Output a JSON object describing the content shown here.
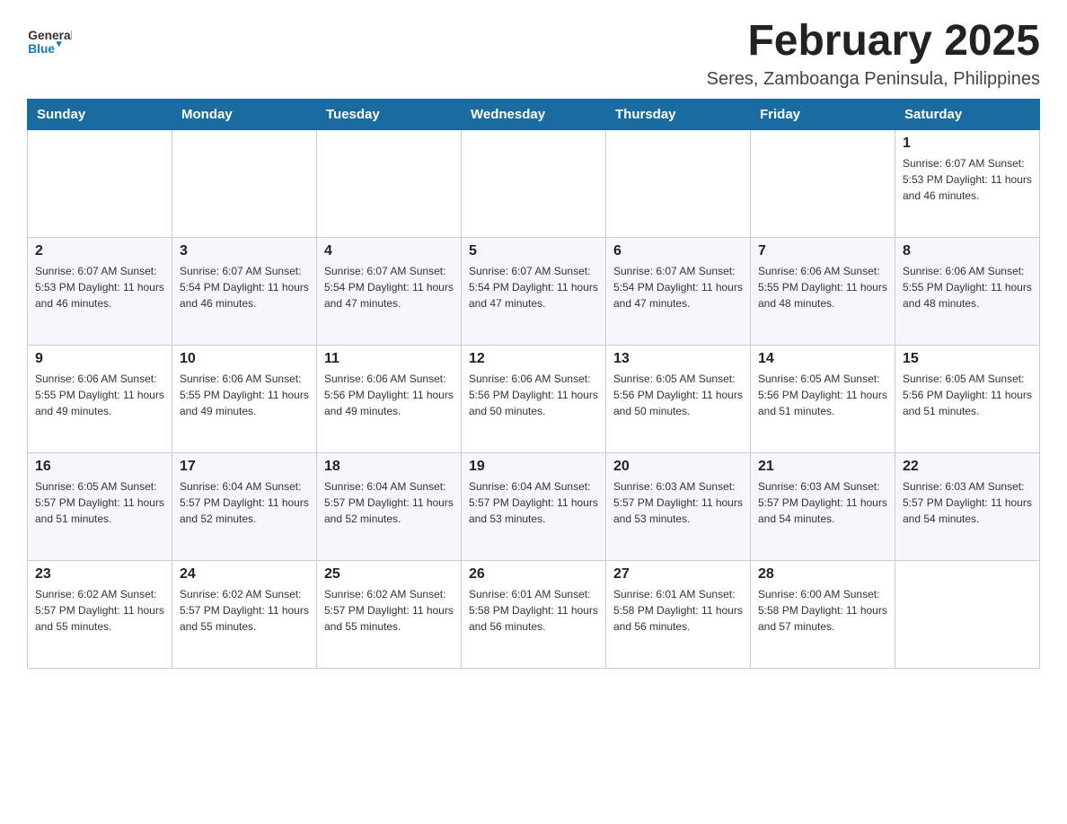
{
  "header": {
    "logo_general": "General",
    "logo_blue": "Blue",
    "month_title": "February 2025",
    "location": "Seres, Zamboanga Peninsula, Philippines"
  },
  "weekdays": [
    "Sunday",
    "Monday",
    "Tuesday",
    "Wednesday",
    "Thursday",
    "Friday",
    "Saturday"
  ],
  "weeks": [
    {
      "days": [
        {
          "num": "",
          "info": ""
        },
        {
          "num": "",
          "info": ""
        },
        {
          "num": "",
          "info": ""
        },
        {
          "num": "",
          "info": ""
        },
        {
          "num": "",
          "info": ""
        },
        {
          "num": "",
          "info": ""
        },
        {
          "num": "1",
          "info": "Sunrise: 6:07 AM\nSunset: 5:53 PM\nDaylight: 11 hours\nand 46 minutes."
        }
      ]
    },
    {
      "days": [
        {
          "num": "2",
          "info": "Sunrise: 6:07 AM\nSunset: 5:53 PM\nDaylight: 11 hours\nand 46 minutes."
        },
        {
          "num": "3",
          "info": "Sunrise: 6:07 AM\nSunset: 5:54 PM\nDaylight: 11 hours\nand 46 minutes."
        },
        {
          "num": "4",
          "info": "Sunrise: 6:07 AM\nSunset: 5:54 PM\nDaylight: 11 hours\nand 47 minutes."
        },
        {
          "num": "5",
          "info": "Sunrise: 6:07 AM\nSunset: 5:54 PM\nDaylight: 11 hours\nand 47 minutes."
        },
        {
          "num": "6",
          "info": "Sunrise: 6:07 AM\nSunset: 5:54 PM\nDaylight: 11 hours\nand 47 minutes."
        },
        {
          "num": "7",
          "info": "Sunrise: 6:06 AM\nSunset: 5:55 PM\nDaylight: 11 hours\nand 48 minutes."
        },
        {
          "num": "8",
          "info": "Sunrise: 6:06 AM\nSunset: 5:55 PM\nDaylight: 11 hours\nand 48 minutes."
        }
      ]
    },
    {
      "days": [
        {
          "num": "9",
          "info": "Sunrise: 6:06 AM\nSunset: 5:55 PM\nDaylight: 11 hours\nand 49 minutes."
        },
        {
          "num": "10",
          "info": "Sunrise: 6:06 AM\nSunset: 5:55 PM\nDaylight: 11 hours\nand 49 minutes."
        },
        {
          "num": "11",
          "info": "Sunrise: 6:06 AM\nSunset: 5:56 PM\nDaylight: 11 hours\nand 49 minutes."
        },
        {
          "num": "12",
          "info": "Sunrise: 6:06 AM\nSunset: 5:56 PM\nDaylight: 11 hours\nand 50 minutes."
        },
        {
          "num": "13",
          "info": "Sunrise: 6:05 AM\nSunset: 5:56 PM\nDaylight: 11 hours\nand 50 minutes."
        },
        {
          "num": "14",
          "info": "Sunrise: 6:05 AM\nSunset: 5:56 PM\nDaylight: 11 hours\nand 51 minutes."
        },
        {
          "num": "15",
          "info": "Sunrise: 6:05 AM\nSunset: 5:56 PM\nDaylight: 11 hours\nand 51 minutes."
        }
      ]
    },
    {
      "days": [
        {
          "num": "16",
          "info": "Sunrise: 6:05 AM\nSunset: 5:57 PM\nDaylight: 11 hours\nand 51 minutes."
        },
        {
          "num": "17",
          "info": "Sunrise: 6:04 AM\nSunset: 5:57 PM\nDaylight: 11 hours\nand 52 minutes."
        },
        {
          "num": "18",
          "info": "Sunrise: 6:04 AM\nSunset: 5:57 PM\nDaylight: 11 hours\nand 52 minutes."
        },
        {
          "num": "19",
          "info": "Sunrise: 6:04 AM\nSunset: 5:57 PM\nDaylight: 11 hours\nand 53 minutes."
        },
        {
          "num": "20",
          "info": "Sunrise: 6:03 AM\nSunset: 5:57 PM\nDaylight: 11 hours\nand 53 minutes."
        },
        {
          "num": "21",
          "info": "Sunrise: 6:03 AM\nSunset: 5:57 PM\nDaylight: 11 hours\nand 54 minutes."
        },
        {
          "num": "22",
          "info": "Sunrise: 6:03 AM\nSunset: 5:57 PM\nDaylight: 11 hours\nand 54 minutes."
        }
      ]
    },
    {
      "days": [
        {
          "num": "23",
          "info": "Sunrise: 6:02 AM\nSunset: 5:57 PM\nDaylight: 11 hours\nand 55 minutes."
        },
        {
          "num": "24",
          "info": "Sunrise: 6:02 AM\nSunset: 5:57 PM\nDaylight: 11 hours\nand 55 minutes."
        },
        {
          "num": "25",
          "info": "Sunrise: 6:02 AM\nSunset: 5:57 PM\nDaylight: 11 hours\nand 55 minutes."
        },
        {
          "num": "26",
          "info": "Sunrise: 6:01 AM\nSunset: 5:58 PM\nDaylight: 11 hours\nand 56 minutes."
        },
        {
          "num": "27",
          "info": "Sunrise: 6:01 AM\nSunset: 5:58 PM\nDaylight: 11 hours\nand 56 minutes."
        },
        {
          "num": "28",
          "info": "Sunrise: 6:00 AM\nSunset: 5:58 PM\nDaylight: 11 hours\nand 57 minutes."
        },
        {
          "num": "",
          "info": ""
        }
      ]
    }
  ]
}
